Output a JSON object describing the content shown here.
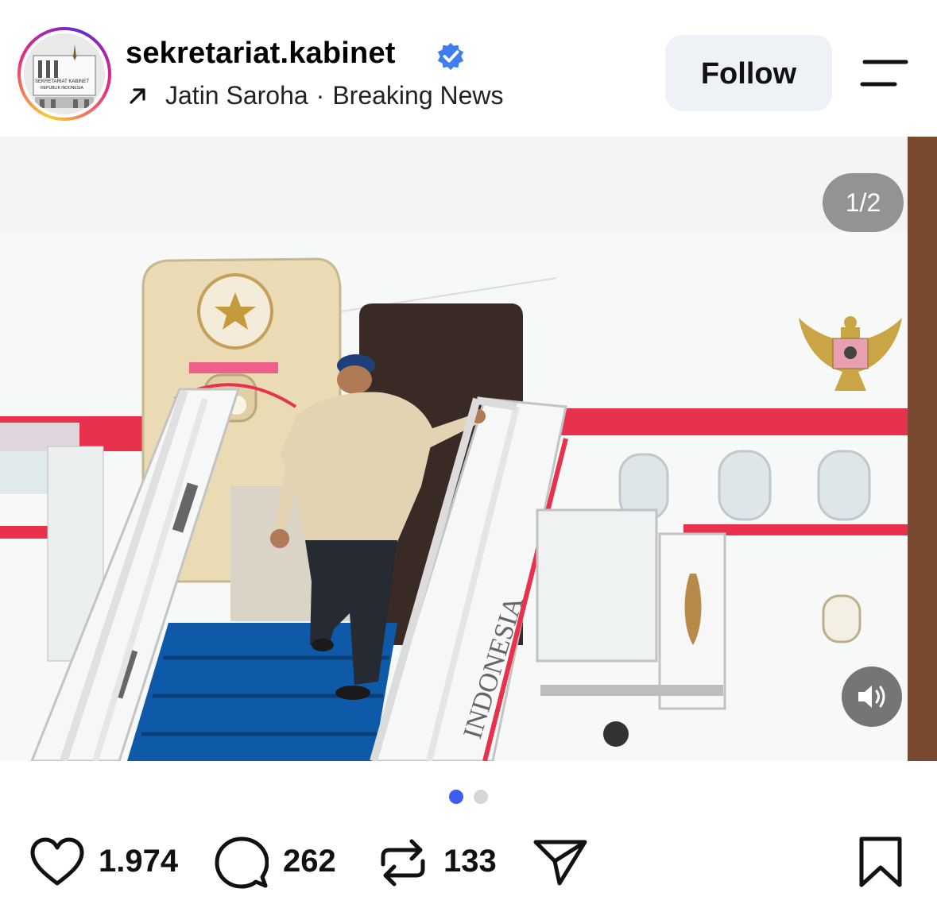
{
  "post": {
    "username": "sekretariat.kabinet",
    "verified": true,
    "subline": {
      "collaborator": "Jatin Saroha",
      "separator": "·",
      "tag": "Breaking News"
    },
    "avatar_text_top": "SEKRETARIAT KABINET",
    "avatar_text_bottom": "REPUBLIK INDONESIA"
  },
  "header": {
    "follow_label": "Follow",
    "menu_icon": "menu-icon"
  },
  "media": {
    "page_indicator": "1/2",
    "current_index": 1,
    "total": 2,
    "stair_text": "INDONESIA",
    "sound_icon": "speaker-icon"
  },
  "carousel": {
    "dots": 2,
    "active_dot": 0,
    "active_color": "#3f5bf0",
    "inactive_color": "#d6d6d6"
  },
  "actions": {
    "likes": "1.974",
    "comments": "262",
    "reposts": "133",
    "icons": [
      "heart-icon",
      "comment-icon",
      "repost-icon",
      "share-icon",
      "bookmark-icon"
    ]
  },
  "colors": {
    "verified_badge": "#3f7ef0",
    "aircraft_red": "#e8324d",
    "stair_carpet": "#0f5aa8"
  }
}
